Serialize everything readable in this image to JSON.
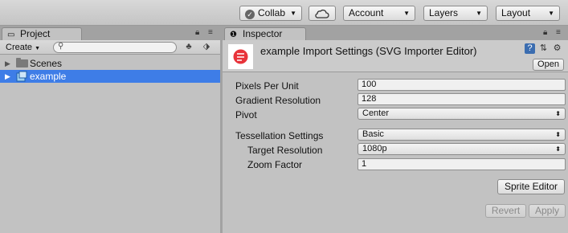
{
  "toolbar": {
    "collab_label": "Collab",
    "account_label": "Account",
    "layers_label": "Layers",
    "layout_label": "Layout"
  },
  "project": {
    "tab_label": "Project",
    "create_label": "Create",
    "search_placeholder": "",
    "items": [
      {
        "label": "Scenes",
        "type": "folder",
        "selected": false
      },
      {
        "label": "example",
        "type": "asset",
        "selected": true
      }
    ]
  },
  "inspector": {
    "tab_label": "Inspector",
    "title": "example Import Settings (SVG Importer Editor)",
    "open_label": "Open",
    "properties": [
      {
        "label": "Pixels Per Unit",
        "value": "100",
        "kind": "field"
      },
      {
        "label": "Gradient Resolution",
        "value": "128",
        "kind": "field"
      },
      {
        "label": "Pivot",
        "value": "Center",
        "kind": "dropdown"
      },
      {
        "label": "Tessellation Settings",
        "value": "Basic",
        "kind": "dropdown"
      },
      {
        "label": "Target Resolution",
        "value": "1080p",
        "kind": "dropdown"
      },
      {
        "label": "Zoom Factor",
        "value": "1",
        "kind": "field"
      }
    ],
    "sprite_editor_label": "Sprite Editor",
    "revert_label": "Revert",
    "apply_label": "Apply"
  },
  "colors": {
    "selection": "#3e7de7",
    "panel": "#c2c2c2",
    "background": "#a2a2a2",
    "asset_icon_red": "#e8333a"
  }
}
